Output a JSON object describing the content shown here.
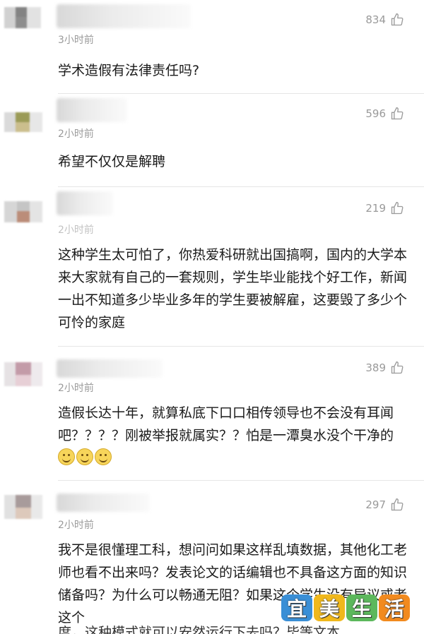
{
  "comments": [
    {
      "time": "3小时前",
      "likes": "834",
      "text": "学术造假有法律责任吗?"
    },
    {
      "time": "2小时前",
      "likes": "596",
      "text": "希望不仅仅是解聘"
    },
    {
      "time": "2小时前",
      "likes": "219",
      "text": "这种学生太可怕了，你热爱科研就出国搞啊，国内的大学本来大家就有自己的一套规则，学生毕业能找个好工作，新闻一出不知道多少毕业多年的学生要被解雇，这要毁了多少个可怜的家庭"
    },
    {
      "time": "2小时前",
      "likes": "389",
      "text": "造假长达十年，就算私底下口口相传领导也不会没有耳闻吧？？？？刚被举报就属实？？怕是一潭臭水没个干净的"
    },
    {
      "time": "2小时前",
      "likes": "297",
      "text": "我不是很懂理工科，想问问如果这样乱填数据，其他化工老师也看不出来吗？发表论文的话编辑也不具备这方面的知识储备吗？为什么可以畅通无阻？如果这个学生没有异议或者这个"
    }
  ],
  "watermark": {
    "chars": [
      "宜",
      "美",
      "生",
      "活"
    ],
    "colors": [
      "#3a8fd6",
      "#f0b81c",
      "#5cb85c",
      "#f28a1e"
    ]
  },
  "cutoff_text": "度，这种模式就可以安然运行下去吗？毕等文本",
  "icons": {
    "like": "thumbs-up-icon"
  }
}
